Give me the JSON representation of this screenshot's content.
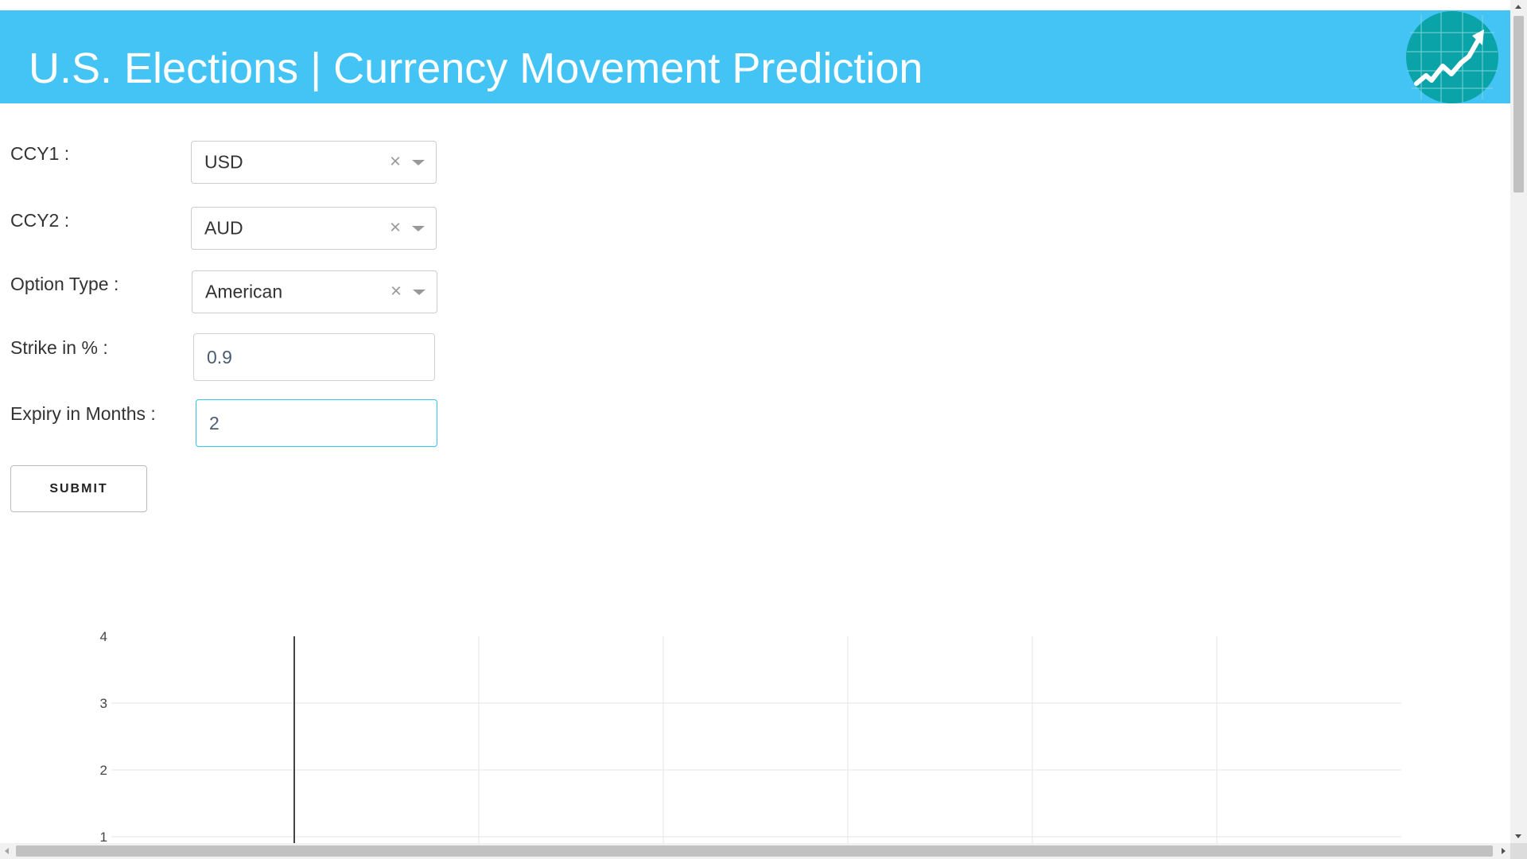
{
  "header": {
    "title": "U.S. Elections | Currency Movement Prediction",
    "background_color": "#44c4f5",
    "logo_icon": "rising-chart-globe-icon",
    "logo_color": "#0aa3a8"
  },
  "form": {
    "ccy1": {
      "label": "CCY1 :",
      "value": "USD"
    },
    "ccy2": {
      "label": "CCY2 :",
      "value": "AUD"
    },
    "option_type": {
      "label": "Option Type :",
      "value": "American"
    },
    "strike": {
      "label": "Strike in % :",
      "value": "0.9"
    },
    "expiry": {
      "label": "Expiry in Months :",
      "value": "2"
    },
    "clear_icon": "×",
    "submit_label": "SUBMIT"
  },
  "chart_data": {
    "type": "line",
    "title": "",
    "xlabel": "",
    "ylabel": "",
    "y_ticks": [
      "1",
      "2",
      "3",
      "4"
    ],
    "ylim": [
      1,
      4
    ],
    "x_tick_labels": [],
    "grid": true,
    "series": []
  }
}
